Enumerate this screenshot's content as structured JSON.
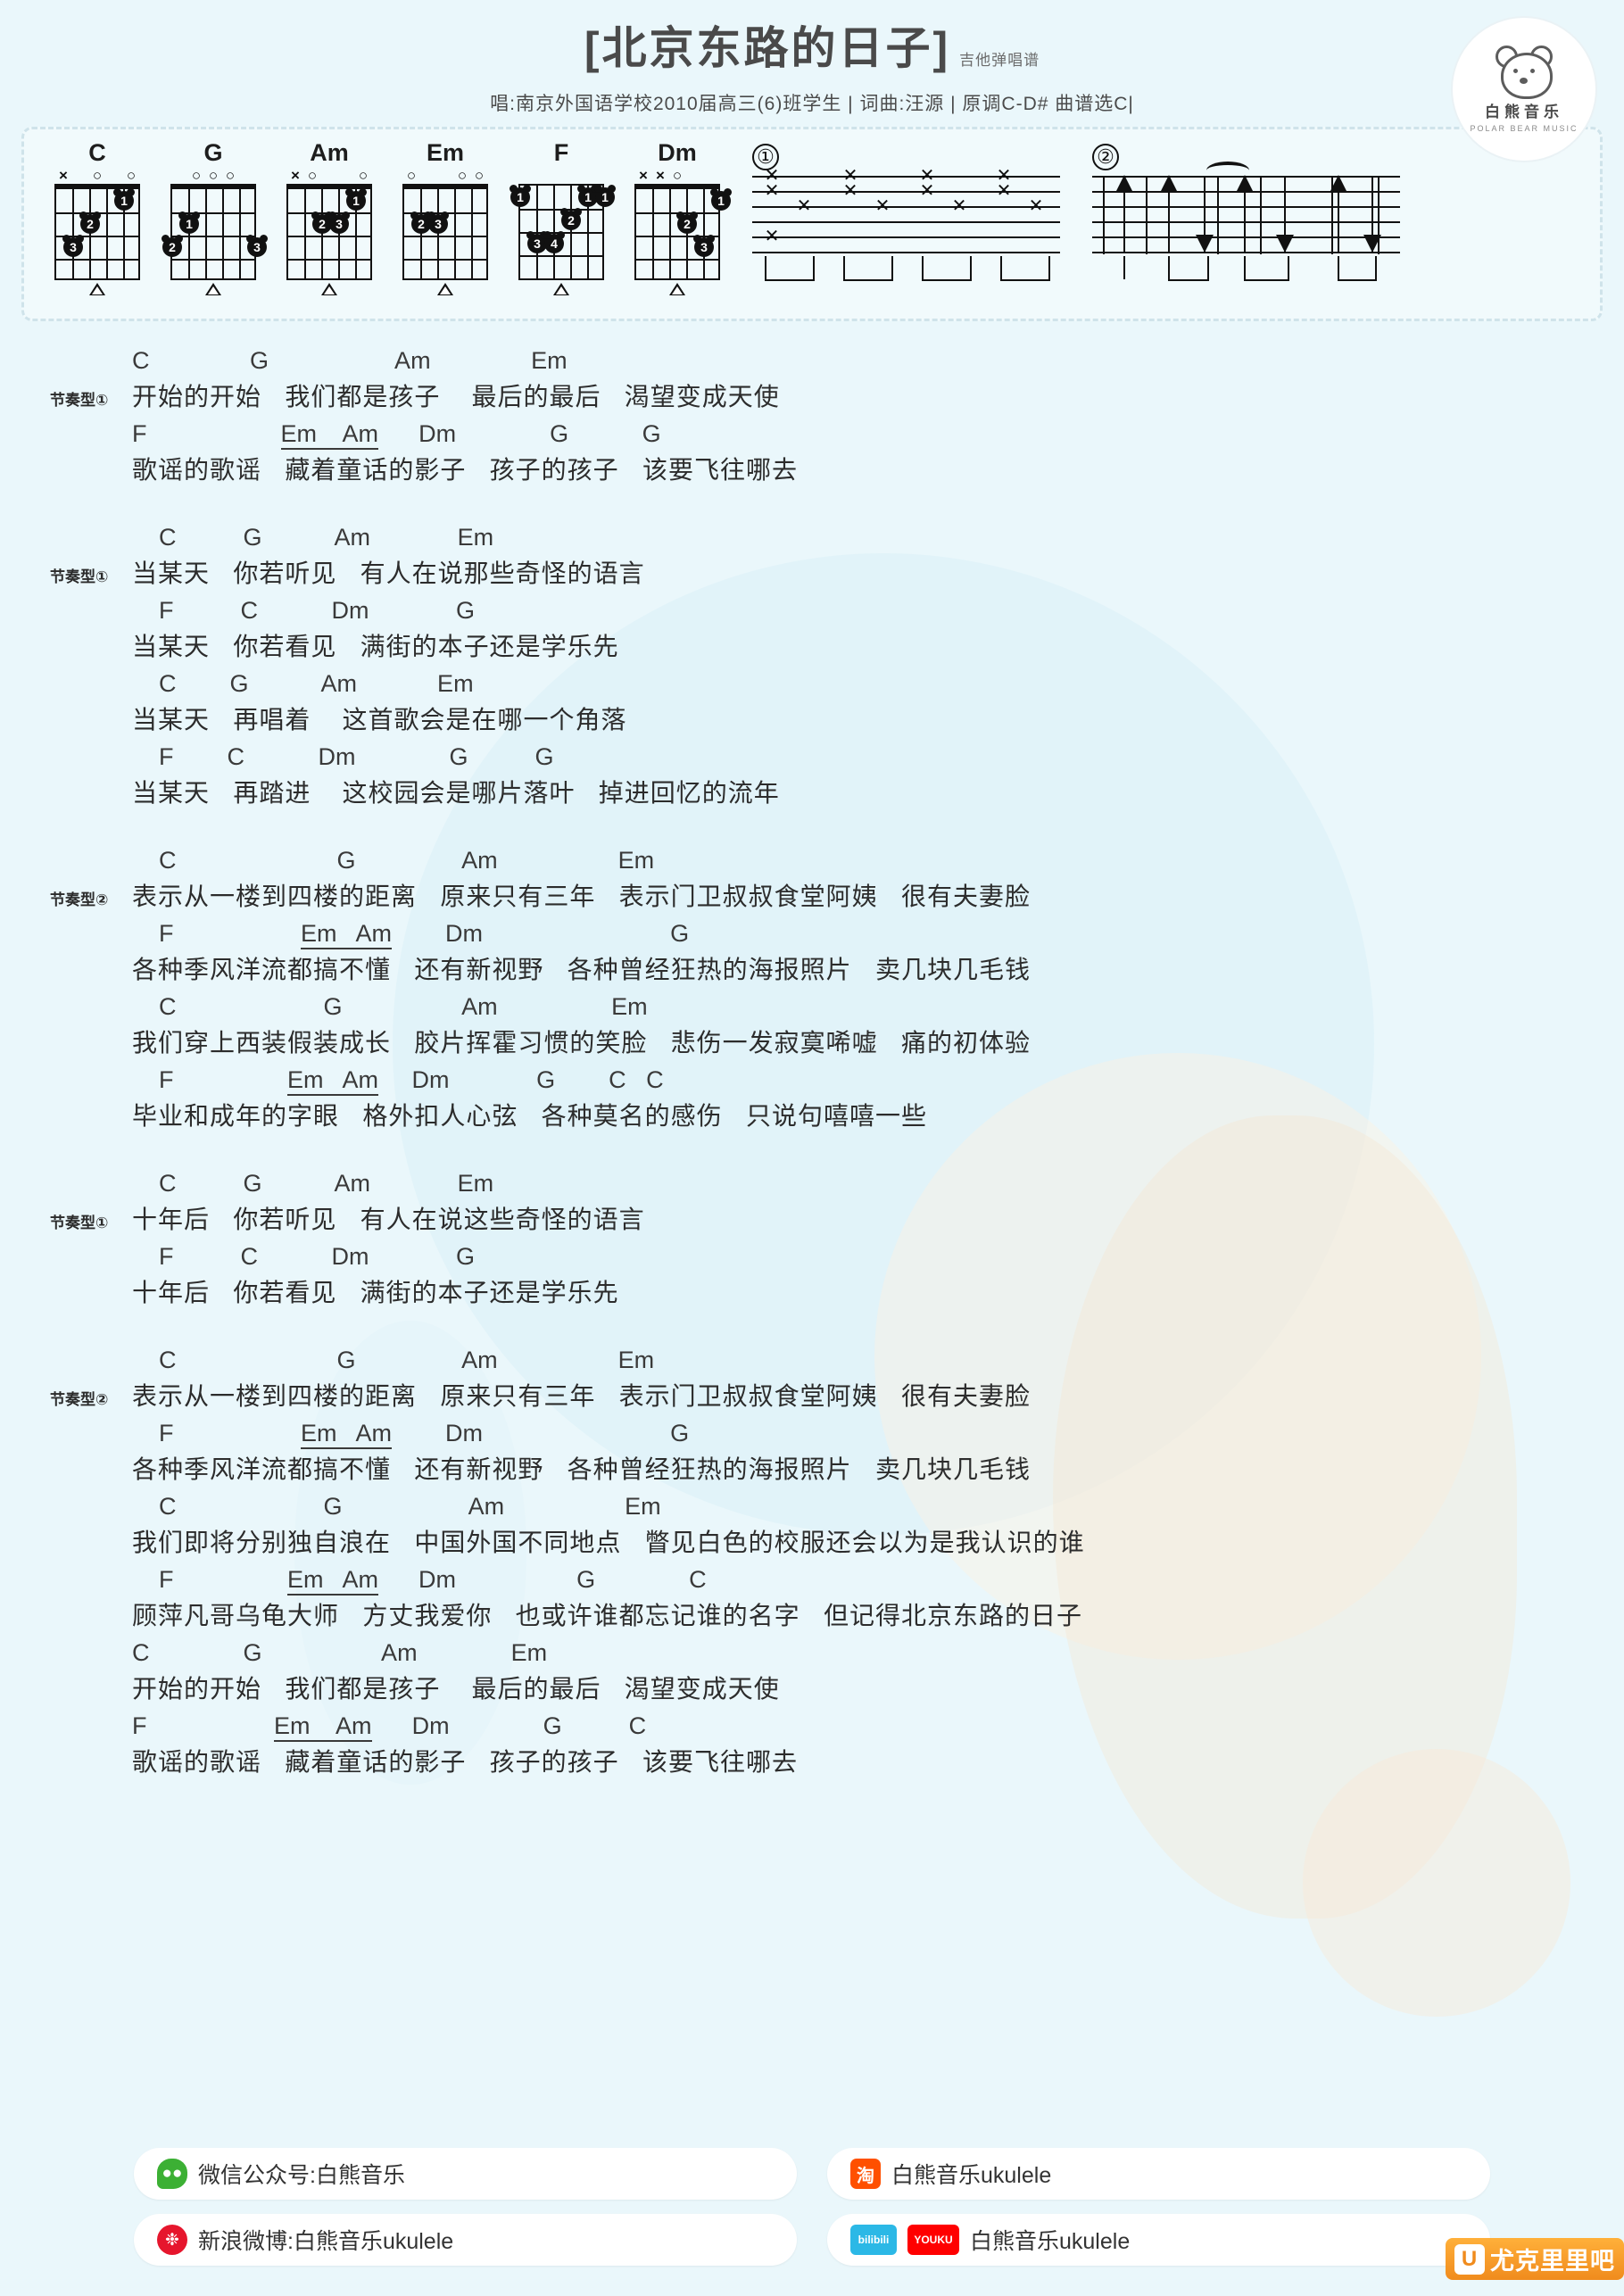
{
  "header": {
    "title": "[北京东路的日子]",
    "subtitle": "吉他弹唱谱",
    "credits": "唱:南京外国语学校2010届高三(6)班学生 | 词曲:汪源 | 原调C-D# 曲谱选C|",
    "logo": {
      "cn": "白熊音乐",
      "en": "POLAR BEAR MUSIC",
      "icon": "polar-bear-icon"
    }
  },
  "chords": [
    {
      "name": "C",
      "markers": [
        {
          "sym": "×",
          "x": 10
        },
        {
          "sym": "○",
          "x": 48
        },
        {
          "sym": "○",
          "x": 86
        }
      ],
      "dots": [
        {
          "f": 1,
          "s": 2,
          "n": "1"
        },
        {
          "f": 2,
          "s": 4,
          "n": "2"
        },
        {
          "f": 3,
          "s": 5,
          "n": "3"
        }
      ]
    },
    {
      "name": "G",
      "markers": [
        {
          "sym": "○",
          "x": 29
        },
        {
          "sym": "○",
          "x": 48
        },
        {
          "sym": "○",
          "x": 67
        }
      ],
      "dots": [
        {
          "f": 2,
          "s": 5,
          "n": "1"
        },
        {
          "f": 3,
          "s": 6,
          "n": "2"
        },
        {
          "f": 3,
          "s": 1,
          "n": "3"
        }
      ]
    },
    {
      "name": "Am",
      "markers": [
        {
          "sym": "×",
          "x": 10
        },
        {
          "sym": "○",
          "x": 29
        },
        {
          "sym": "○",
          "x": 86
        }
      ],
      "dots": [
        {
          "f": 1,
          "s": 2,
          "n": "1"
        },
        {
          "f": 2,
          "s": 4,
          "n": "2"
        },
        {
          "f": 2,
          "s": 3,
          "n": "3"
        }
      ]
    },
    {
      "name": "Em",
      "markers": [
        {
          "sym": "○",
          "x": 10
        },
        {
          "sym": "○",
          "x": 67
        },
        {
          "sym": "○",
          "x": 86
        }
      ],
      "dots": [
        {
          "f": 2,
          "s": 5,
          "n": "2"
        },
        {
          "f": 2,
          "s": 4,
          "n": "3"
        }
      ]
    },
    {
      "name": "F",
      "markers": [],
      "dots": [
        {
          "f": 1,
          "s": 6,
          "n": "1"
        },
        {
          "f": 1,
          "s": 2,
          "n": "1"
        },
        {
          "f": 1,
          "s": 1,
          "n": "1"
        },
        {
          "f": 2,
          "s": 3,
          "n": "2"
        },
        {
          "f": 3,
          "s": 5,
          "n": "3"
        },
        {
          "f": 3,
          "s": 4,
          "n": "4"
        }
      ]
    },
    {
      "name": "Dm",
      "markers": [
        {
          "sym": "×",
          "x": 10
        },
        {
          "sym": "×",
          "x": 29
        },
        {
          "sym": "○",
          "x": 48
        }
      ],
      "dots": [
        {
          "f": 1,
          "s": 1,
          "n": "1"
        },
        {
          "f": 2,
          "s": 3,
          "n": "2"
        },
        {
          "f": 3,
          "s": 2,
          "n": "3"
        }
      ]
    }
  ],
  "rhythms": [
    {
      "label": "①",
      "type": "x-pattern"
    },
    {
      "label": "②",
      "type": "arrow-pattern"
    }
  ],
  "sections": [
    {
      "tag": "节奏型①",
      "rows": [
        {
          "chords": "C               G                   Am               Em",
          "lyric": "开始的开始   我们都是孩子    最后的最后   渴望变成天使"
        },
        {
          "chords": "F                    Em____Am      Dm              G           G",
          "lyric": "歌谣的歌谣   藏着童话的影子   孩子的孩子   该要飞往哪去"
        }
      ]
    },
    {
      "tag": "节奏型①",
      "rows": [
        {
          "chords": "    C          G           Am             Em",
          "lyric": "当某天   你若听见   有人在说那些奇怪的语言"
        },
        {
          "chords": "    F          C           Dm             G",
          "lyric": "当某天   你若看见   满街的本子还是学乐先"
        },
        {
          "chords": "    C        G           Am            Em",
          "lyric": "当某天   再唱着    这首歌会是在哪一个角落"
        },
        {
          "chords": "    F        C           Dm              G          G",
          "lyric": "当某天   再踏进    这校园会是哪片落叶   掉进回忆的流年"
        }
      ]
    },
    {
      "tag": "节奏型②",
      "rows": [
        {
          "chords": "    C                        G                Am                  Em",
          "lyric": "表示从一楼到四楼的距离   原来只有三年   表示门卫叔叔食堂阿姨   很有夫妻脸"
        },
        {
          "chords": "    F                   Em___Am        Dm                            G",
          "lyric": "各种季风洋流都搞不懂   还有新视野   各种曾经狂热的海报照片   卖几块几毛钱"
        },
        {
          "chords": "    C                      G                  Am                 Em",
          "lyric": "我们穿上西装假装成长   胶片挥霍习惯的笑脸   悲伤一发寂寞唏嘘   痛的初体验"
        },
        {
          "chords": "    F                 Em___Am     Dm             G        C   C",
          "lyric": "毕业和成年的字眼   格外扣人心弦   各种莫名的感伤   只说句嘻嘻一些"
        }
      ]
    },
    {
      "tag": "节奏型①",
      "rows": [
        {
          "chords": "    C          G           Am             Em",
          "lyric": "十年后   你若听见   有人在说这些奇怪的语言"
        },
        {
          "chords": "    F          C           Dm             G",
          "lyric": "十年后   你若看见   满街的本子还是学乐先"
        }
      ]
    },
    {
      "tag": "节奏型②",
      "rows": [
        {
          "chords": "    C                        G                Am                  Em",
          "lyric": "表示从一楼到四楼的距离   原来只有三年   表示门卫叔叔食堂阿姨   很有夫妻脸"
        },
        {
          "chords": "    F                   Em___Am        Dm                            G",
          "lyric": "各种季风洋流都搞不懂   还有新视野   各种曾经狂热的海报照片   卖几块几毛钱"
        },
        {
          "chords": "    C                      G                   Am                  Em",
          "lyric": "我们即将分别独自浪在   中国外国不同地点   瞥见白色的校服还会以为是我认识的谁"
        },
        {
          "chords": "    F                 Em___Am      Dm                  G              C",
          "lyric": "顾萍凡哥乌龟大师   方丈我爱你   也或许谁都忘记谁的名字   但记得北京东路的日子"
        },
        {
          "chords": "C              G                  Am              Em",
          "lyric": "开始的开始   我们都是孩子    最后的最后   渴望变成天使"
        },
        {
          "chords": "F                   Em____Am      Dm              G          C",
          "lyric": "歌谣的歌谣   藏着童话的影子   孩子的孩子   该要飞往哪去"
        }
      ]
    }
  ],
  "footer": {
    "buttons": [
      {
        "icon": "wechat-icon",
        "glyph": "",
        "label": "微信公众号:白熊音乐"
      },
      {
        "icon": "taobao-icon",
        "glyph": "淘",
        "label": "白熊音乐ukulele"
      },
      {
        "icon": "weibo-icon",
        "glyph": "",
        "label": "新浪微博:白熊音乐ukulele"
      },
      {
        "icon": "bilibili-youku-icon",
        "glyph": "bilibili",
        "glyph2": "YOUKU",
        "label": "白熊音乐ukulele"
      }
    ],
    "watermark": {
      "badge": "U",
      "text": "尤克里里吧"
    }
  },
  "colors": {
    "background": "#eaf7fb",
    "ink": "#3a3a3a",
    "wechat": "#3cb034",
    "taobao": "#ff5000",
    "weibo": "#e6162d",
    "bilibili": "#2bb8e6",
    "youku": "#ff0000",
    "accent": "#f08b1d"
  }
}
